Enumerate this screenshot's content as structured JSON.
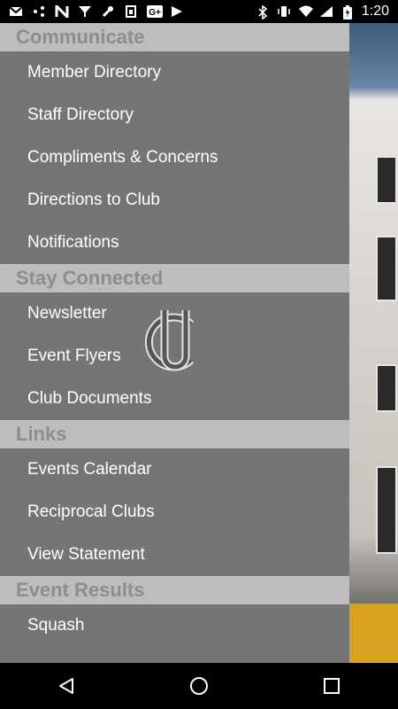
{
  "status": {
    "time": "1:20",
    "left_icons": [
      "gmail-icon",
      "nodes-icon",
      "n-logo-icon",
      "cup-icon",
      "wrench-icon",
      "sim-icon",
      "google-plus-icon",
      "play-icon"
    ],
    "right_icons": [
      "bluetooth-icon",
      "vibrate-icon",
      "wifi-icon",
      "signal-icon",
      "battery-icon"
    ]
  },
  "drawer": {
    "sections": [
      {
        "title": "Communicate",
        "items": [
          "Member Directory",
          "Staff Directory",
          "Compliments & Concerns",
          "Directions to Club",
          "Notifications"
        ]
      },
      {
        "title": "Stay Connected",
        "items": [
          "Newsletter",
          "Event Flyers",
          "Club Documents"
        ]
      },
      {
        "title": "Links",
        "items": [
          "Events Calendar",
          "Reciprocal Clubs",
          "View Statement"
        ]
      },
      {
        "title": "Event Results",
        "items": [
          "Squash"
        ]
      }
    ]
  },
  "nav": {
    "back": "back-icon",
    "home": "home-icon",
    "recents": "recents-icon"
  }
}
